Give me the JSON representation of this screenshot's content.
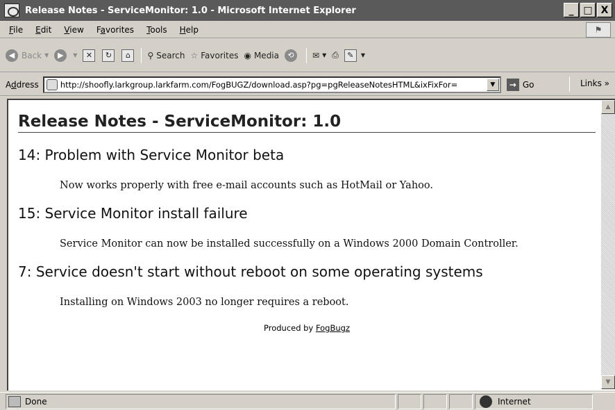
{
  "window": {
    "title": "Release Notes - ServiceMonitor: 1.0 - Microsoft Internet Explorer",
    "buttons": {
      "minimize": "_",
      "maximize": "□",
      "close": "X"
    }
  },
  "menu": {
    "items": [
      {
        "pre": "",
        "key": "F",
        "post": "ile"
      },
      {
        "pre": "",
        "key": "E",
        "post": "dit"
      },
      {
        "pre": "",
        "key": "V",
        "post": "iew"
      },
      {
        "pre": "F",
        "key": "a",
        "post": "vorites"
      },
      {
        "pre": "",
        "key": "T",
        "post": "ools"
      },
      {
        "pre": "",
        "key": "H",
        "post": "elp"
      }
    ]
  },
  "toolbar": {
    "back": "Back",
    "search": "Search",
    "favorites": "Favorites",
    "media": "Media"
  },
  "address": {
    "label_pre": "A",
    "label_key": "d",
    "label_post": "dress",
    "url": "http://shoofly.larkgroup.larkfarm.com/FogBUGZ/download.asp?pg=pgReleaseNotesHTML&ixFixFor=",
    "go": "Go",
    "links": "Links"
  },
  "page": {
    "heading": "Release Notes - ServiceMonitor: 1.0",
    "cases": [
      {
        "title": "14: Problem with Service Monitor beta",
        "note": "Now works properly with free e-mail accounts such as HotMail or Yahoo."
      },
      {
        "title": "15: Service Monitor install failure",
        "note": "Service Monitor can now be installed successfully on a Windows 2000 Domain Controller."
      },
      {
        "title": "7: Service doesn't start without reboot on some operating systems",
        "note": "Installing on Windows 2003 no longer requires a reboot."
      }
    ],
    "footer_prefix": "Produced by ",
    "footer_link": "FogBugz"
  },
  "status": {
    "text": "Done",
    "zone": "Internet"
  }
}
